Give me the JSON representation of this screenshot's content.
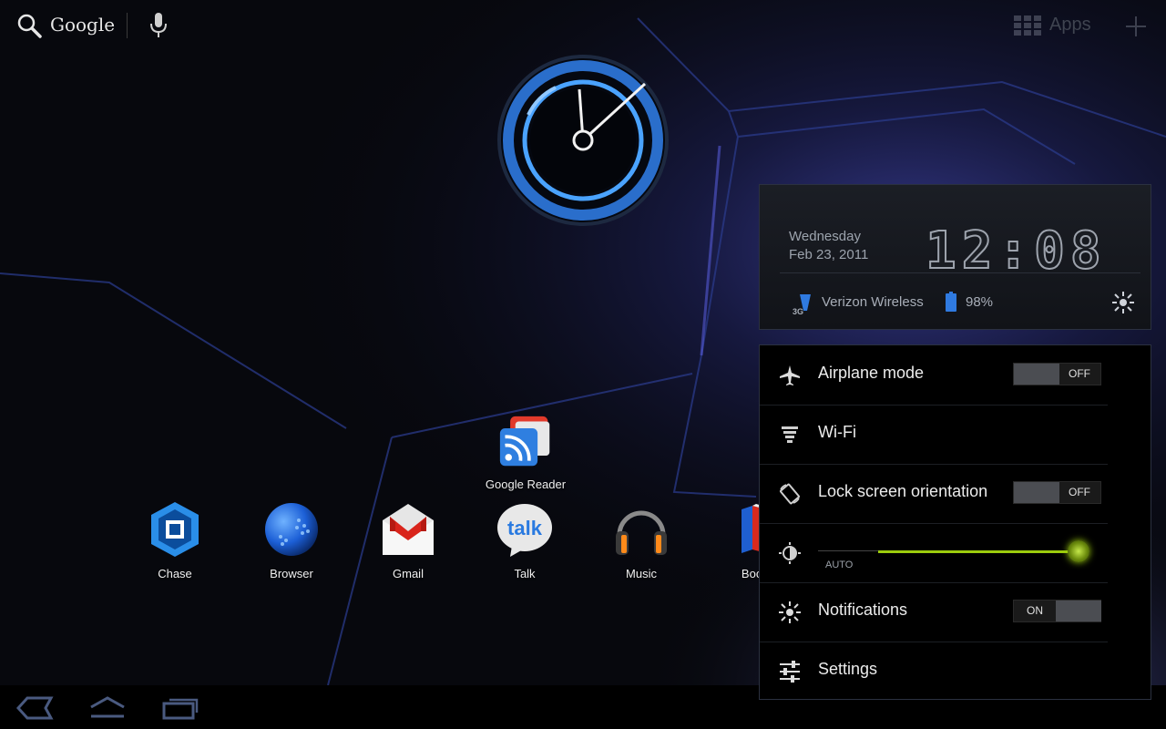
{
  "topbar": {
    "search_label": "Google",
    "apps_label": "Apps"
  },
  "home": {
    "featured_app": {
      "label": "Google Reader",
      "icon": "google-reader-icon"
    },
    "dock": [
      {
        "label": "Chase",
        "icon": "chase-icon"
      },
      {
        "label": "Browser",
        "icon": "browser-icon"
      },
      {
        "label": "Gmail",
        "icon": "gmail-icon"
      },
      {
        "label": "Talk",
        "icon": "talk-icon"
      },
      {
        "label": "Music",
        "icon": "music-icon"
      },
      {
        "label": "Books",
        "icon": "books-icon"
      }
    ],
    "talk_glyph_text": "talk"
  },
  "status": {
    "day": "Wednesday",
    "date": "Feb 23, 2011",
    "time": "12:08",
    "network_type": "3G",
    "carrier": "Verizon Wireless",
    "battery": "98%"
  },
  "quick_settings": {
    "airplane": {
      "label": "Airplane mode",
      "state": "OFF",
      "icon": "airplane-icon"
    },
    "wifi": {
      "label": "Wi-Fi",
      "icon": "wifi-icon"
    },
    "orientation": {
      "label": "Lock screen orientation",
      "state": "OFF",
      "icon": "rotation-icon"
    },
    "brightness": {
      "auto_label": "AUTO",
      "level": 0.95,
      "icon": "brightness-icon"
    },
    "notifications": {
      "label": "Notifications",
      "state": "ON",
      "icon": "notifications-icon"
    },
    "settings": {
      "label": "Settings",
      "icon": "settings-sliders-icon"
    }
  },
  "colors": {
    "accent": "#9ccc0d",
    "clock_blue": "#4aa3ff",
    "background": "#07080d"
  }
}
